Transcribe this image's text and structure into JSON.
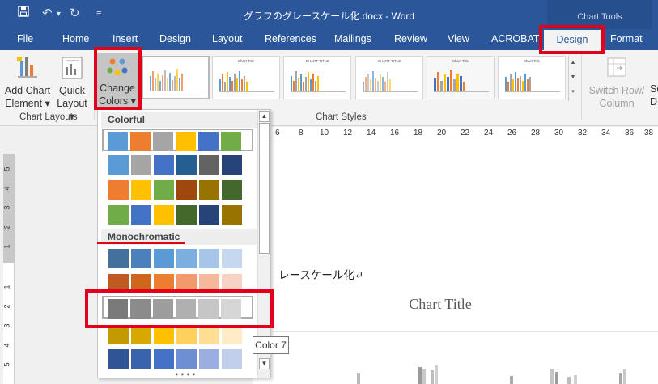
{
  "window": {
    "title": "グラフのグレースケール化.docx - Word",
    "chart_tools_label": "Chart Tools",
    "qat": {
      "save_icon": "save-icon",
      "undo_icon": "undo-icon",
      "redo_icon": "redo-icon",
      "customize_icon": "chevron-down-icon"
    }
  },
  "tabs": [
    {
      "label": "File"
    },
    {
      "label": "Home"
    },
    {
      "label": "Insert"
    },
    {
      "label": "Design"
    },
    {
      "label": "Layout"
    },
    {
      "label": "References"
    },
    {
      "label": "Mailings"
    },
    {
      "label": "Review"
    },
    {
      "label": "View"
    },
    {
      "label": "ACROBAT"
    },
    {
      "label": "Design"
    },
    {
      "label": "Format"
    }
  ],
  "active_tab_index": 10,
  "ribbon": {
    "add_chart_element": {
      "line1": "Add Chart",
      "line2": "Element"
    },
    "quick_layout": {
      "line1": "Quick",
      "line2": "Layout"
    },
    "change_colors": {
      "line1": "Change",
      "line2": "Colors"
    },
    "switch_row_column": {
      "line1": "Switch Row/",
      "line2": "Column"
    },
    "select_data_partial": {
      "line1": "Se",
      "line2": "D"
    },
    "groups": {
      "chart_layouts": "Chart Layouts",
      "chart_styles": "Chart Styles"
    },
    "style_thumb_titles": [
      "",
      "Chart Title",
      "CHART TITLE",
      "CHART TITLE",
      "Chart Title",
      "Chart Title",
      "Chart Title"
    ]
  },
  "ruler_numbers": [
    "6",
    "8",
    "10",
    "12",
    "14",
    "16",
    "18",
    "20",
    "22",
    "24",
    "26",
    "28",
    "30",
    "32",
    "34",
    "36",
    "38"
  ],
  "vertical_ruler_numbers": [
    "5",
    "4",
    "3",
    "2",
    "1",
    "1",
    "2",
    "3",
    "4",
    "5"
  ],
  "document": {
    "paragraph_text": "レースケール化↵",
    "chart_title": "Chart Title"
  },
  "color_dropdown": {
    "colorful_header": "Colorful",
    "monochromatic_header": "Monochromatic",
    "colorful_rows": [
      [
        "#5b9bd5",
        "#ed7d31",
        "#a5a5a5",
        "#ffc000",
        "#4472c4",
        "#70ad47"
      ],
      [
        "#5b9bd5",
        "#a5a5a5",
        "#4472c4",
        "#255e91",
        "#636363",
        "#264478"
      ],
      [
        "#ed7d31",
        "#ffc000",
        "#70ad47",
        "#9e480e",
        "#997300",
        "#43682b"
      ],
      [
        "#70ad47",
        "#4472c4",
        "#ffc000",
        "#43682b",
        "#264478",
        "#997300"
      ]
    ],
    "monochromatic_rows": [
      [
        "#44709d",
        "#4b80bd",
        "#5b9bd5",
        "#7daee0",
        "#a6c5e8",
        "#c6d8ef"
      ],
      [
        "#c05a23",
        "#d0651e",
        "#ed7d31",
        "#f29a6c",
        "#f5b89a",
        "#f8d3c3"
      ],
      [
        "#7a7a7a",
        "#8b8b8b",
        "#9d9d9d",
        "#b0b0b0",
        "#c6c6c6",
        "#d6d6d6"
      ],
      [
        "#c49a00",
        "#d6a800",
        "#ffc000",
        "#ffd15c",
        "#ffdf94",
        "#ffecc4"
      ],
      [
        "#2f5597",
        "#3a63ad",
        "#4472c4",
        "#6e8fd2",
        "#9aafdf",
        "#c2cfec"
      ]
    ],
    "selected_row": "monochromatic-3",
    "tooltip": "Color 7"
  },
  "colors": {
    "accent": "#2b579a",
    "annotation_red": "#e2001a"
  }
}
